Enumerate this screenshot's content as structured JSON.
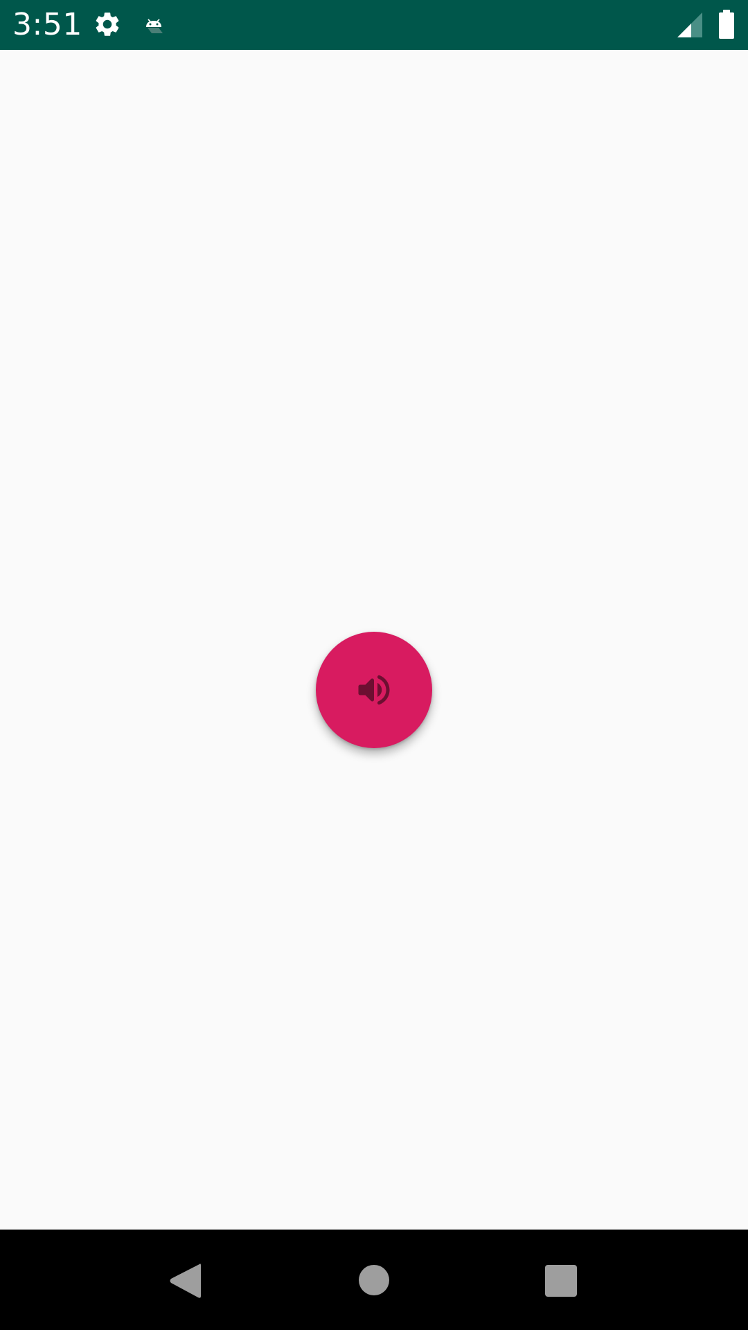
{
  "status_bar": {
    "time": "3:51",
    "background_color": "#00574b",
    "icons": [
      "gear-icon",
      "android-debug-icon",
      "signal-icon",
      "battery-icon"
    ]
  },
  "main": {
    "background_color": "#fafafa",
    "fab": {
      "icon": "volume-up-icon",
      "color": "#d81b60",
      "icon_color": "#6d0f31"
    }
  },
  "nav_bar": {
    "background_color": "#000000",
    "buttons": [
      "back",
      "home",
      "recents"
    ],
    "button_color": "#9e9e9e"
  }
}
